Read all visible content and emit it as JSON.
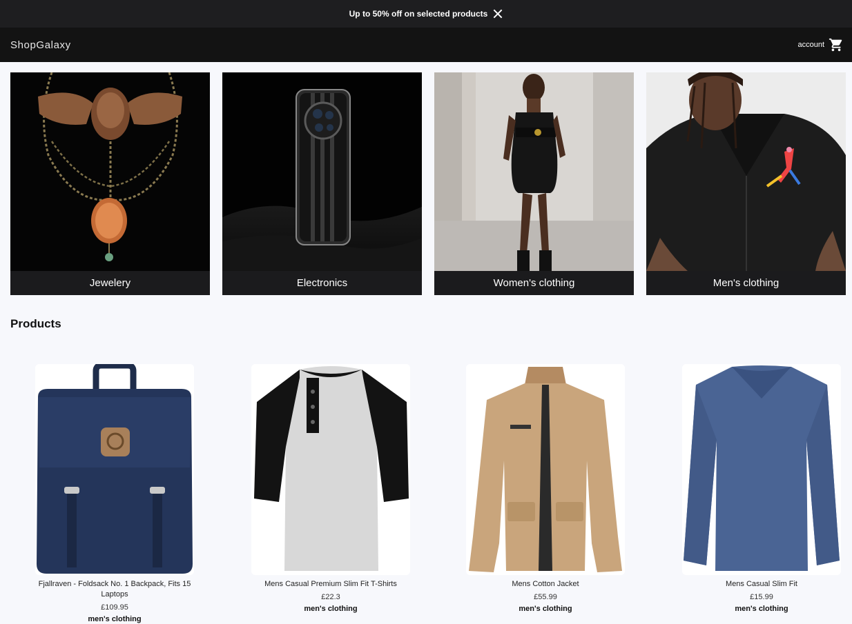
{
  "promo": {
    "text": "Up to 50% off on selected products"
  },
  "header": {
    "logo": "ShopGalaxy",
    "account_label": "account"
  },
  "categories": [
    {
      "label": "Jewelery"
    },
    {
      "label": "Electronics"
    },
    {
      "label": "Women's clothing"
    },
    {
      "label": "Men's clothing"
    }
  ],
  "products_title": "Products",
  "products": [
    {
      "title": "Fjallraven - Foldsack No. 1 Backpack, Fits 15 Laptops",
      "price": "£109.95",
      "category": "men's clothing"
    },
    {
      "title": "Mens Casual Premium Slim Fit T-Shirts",
      "price": "£22.3",
      "category": "men's clothing"
    },
    {
      "title": "Mens Cotton Jacket",
      "price": "£55.99",
      "category": "men's clothing"
    },
    {
      "title": "Mens Casual Slim Fit",
      "price": "£15.99",
      "category": "men's clothing"
    }
  ]
}
